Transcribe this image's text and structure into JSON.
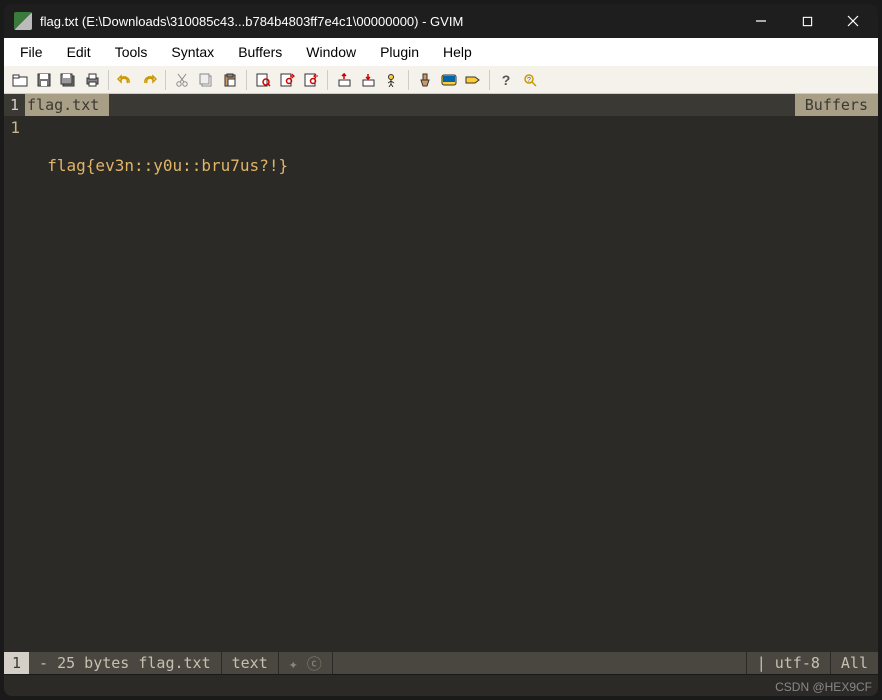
{
  "titlebar": {
    "text": "flag.txt (E:\\Downloads\\310085c43...b784b4803ff7e4c1\\00000000) - GVIM"
  },
  "menu": {
    "file": "File",
    "edit": "Edit",
    "tools": "Tools",
    "syntax": "Syntax",
    "buffers": "Buffers",
    "window": "Window",
    "plugin": "Plugin",
    "help": "Help"
  },
  "buffer_header": {
    "number": "1",
    "name": "flag.txt",
    "panel_label": "Buffers"
  },
  "editor": {
    "line_number": "1",
    "content": "  flag{ev3n::y0u::bru7us?!}"
  },
  "status": {
    "line": "1",
    "fileinfo": "- 25 bytes flag.txt",
    "filetype": "text",
    "flags": "✦ ⓒ",
    "encoding": "| utf-8",
    "position": "All"
  },
  "watermark": "CSDN @HEX9CF"
}
